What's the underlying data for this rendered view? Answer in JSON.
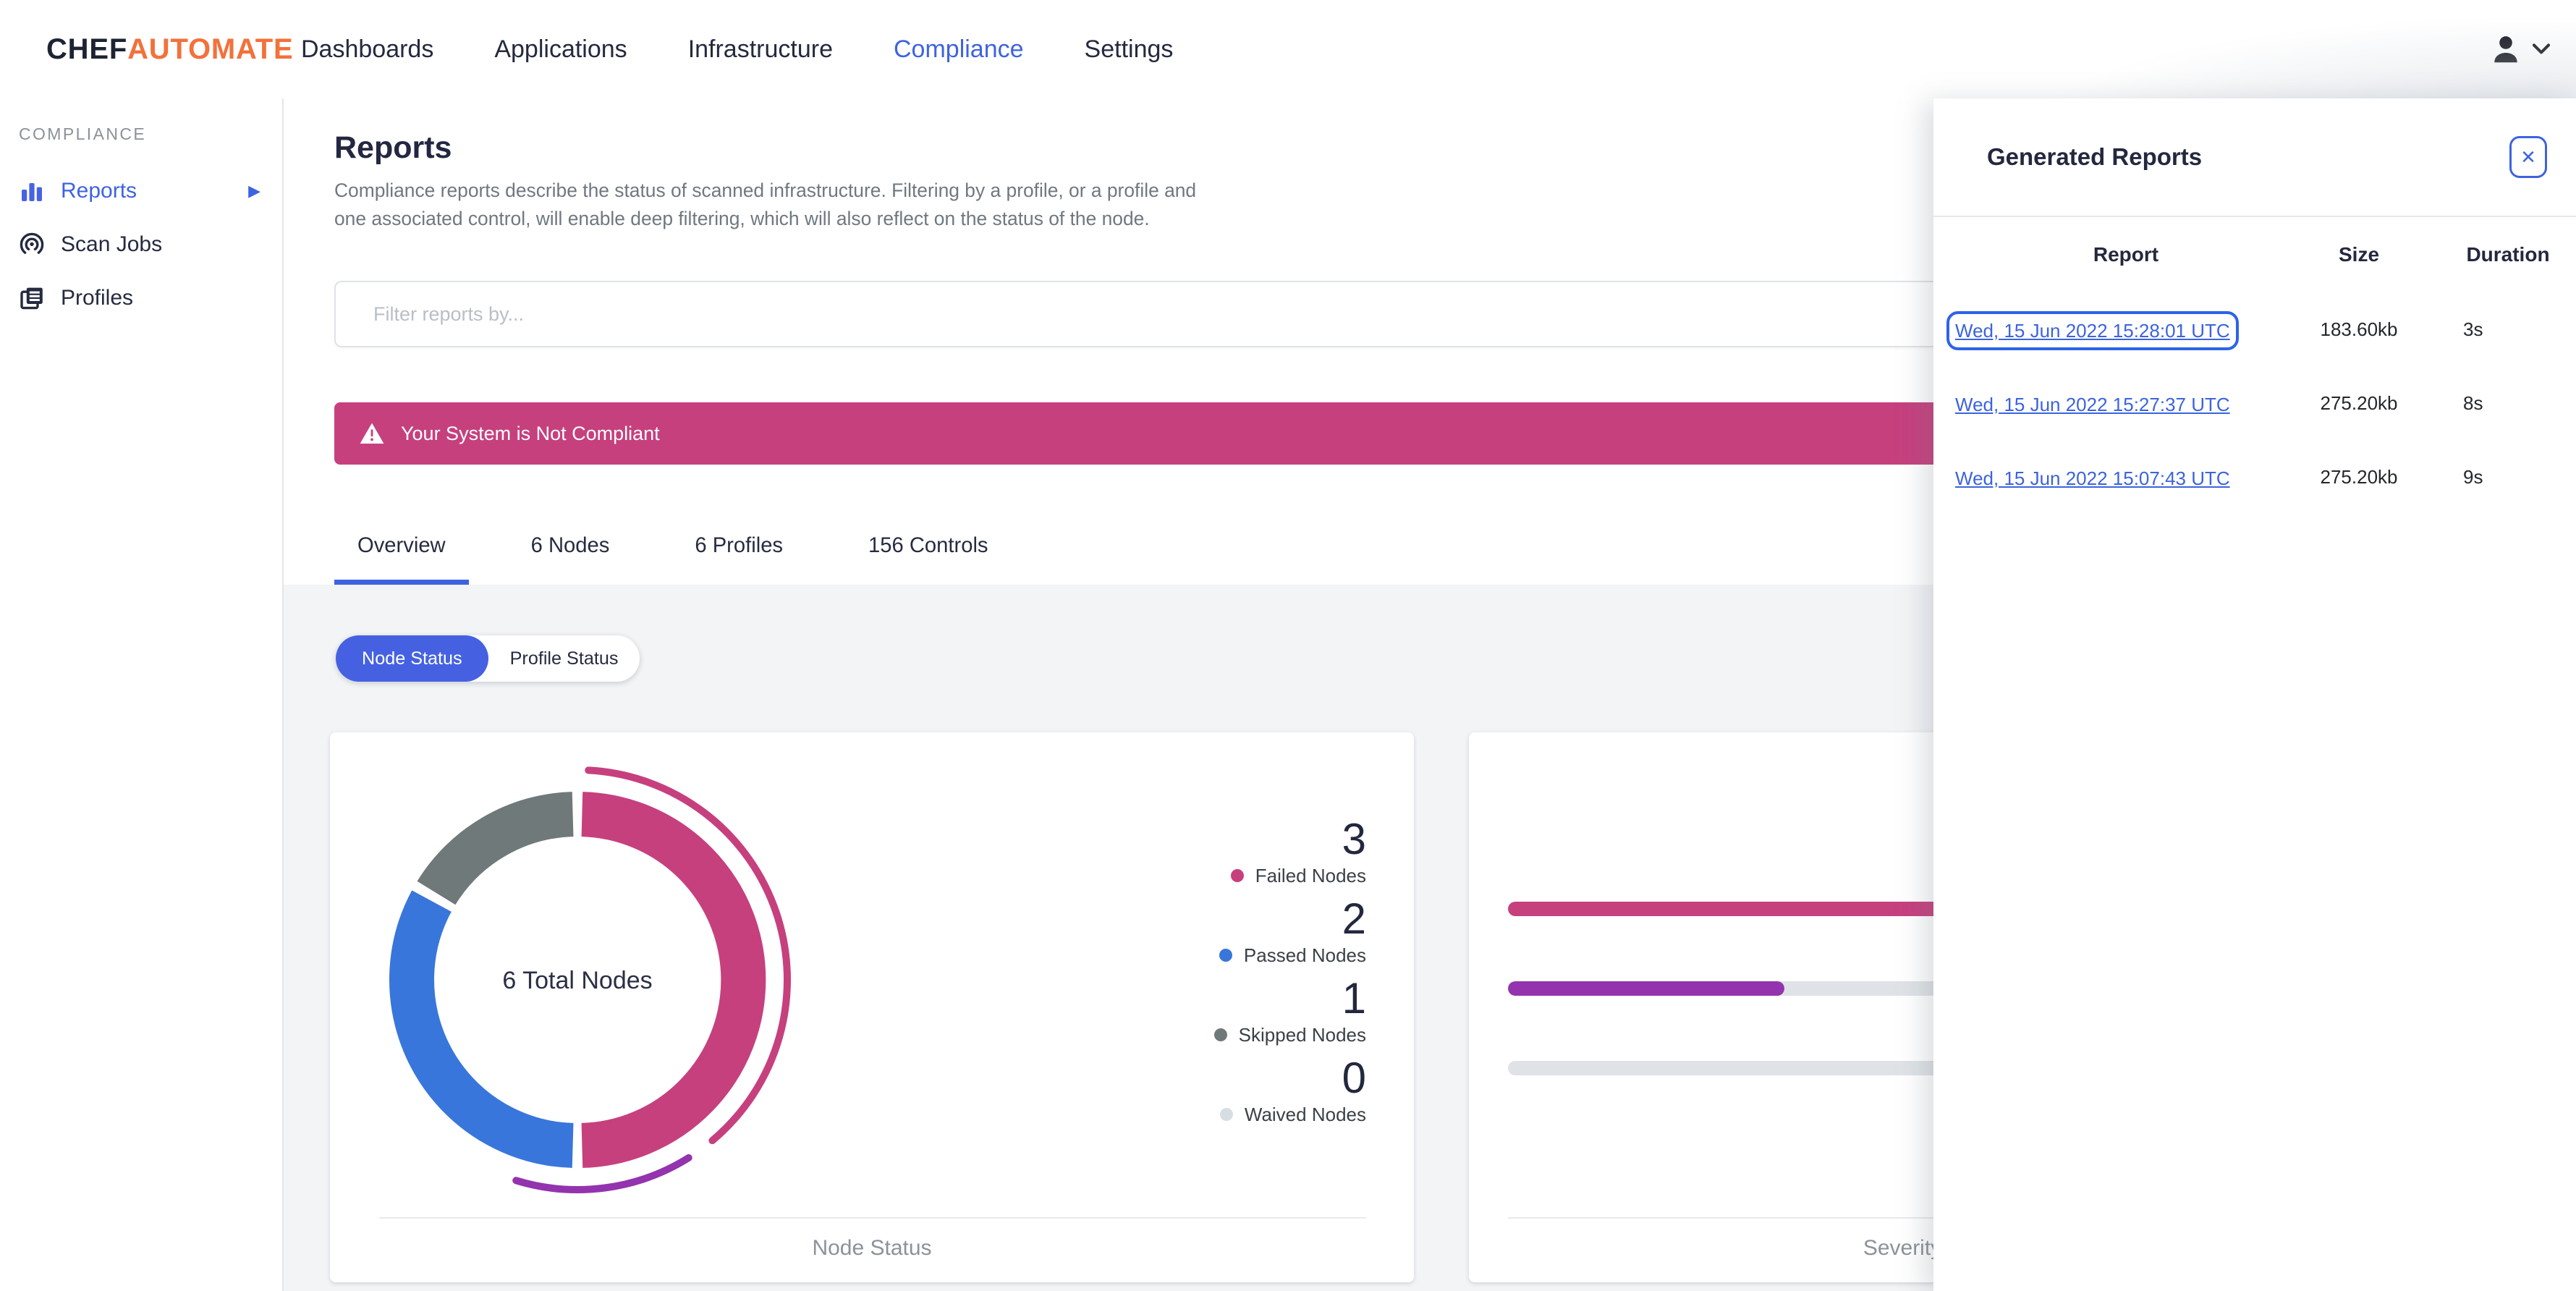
{
  "topnav": {
    "brand": {
      "part1": "CHEF",
      "part2": "AUTOMATE"
    },
    "items": [
      {
        "label": "Dashboards",
        "active": false
      },
      {
        "label": "Applications",
        "active": false
      },
      {
        "label": "Infrastructure",
        "active": false
      },
      {
        "label": "Compliance",
        "active": true
      },
      {
        "label": "Settings",
        "active": false
      }
    ]
  },
  "sidebar": {
    "section_label": "COMPLIANCE",
    "items": [
      {
        "label": "Reports",
        "icon": "bar-chart-icon",
        "active": true
      },
      {
        "label": "Scan Jobs",
        "icon": "scan-icon",
        "active": false
      },
      {
        "label": "Profiles",
        "icon": "documents-icon",
        "active": false
      }
    ]
  },
  "page": {
    "title": "Reports",
    "description": "Compliance reports describe the status of scanned infrastructure. Filtering by a profile, or a profile and\none associated control, will enable deep filtering, which will also reflect on the status of the node."
  },
  "filter": {
    "placeholder": "Filter reports by...",
    "value": ""
  },
  "banner": {
    "text": "Your System is Not Compliant",
    "color": "#C6407E",
    "icon": "warning-icon"
  },
  "tabs": [
    {
      "label": "Overview",
      "active": true
    },
    {
      "label": "6 Nodes",
      "active": false
    },
    {
      "label": "6 Profiles",
      "active": false
    },
    {
      "label": "156 Controls",
      "active": false
    }
  ],
  "status_toggle": [
    {
      "label": "Node Status",
      "active": true
    },
    {
      "label": "Profile Status",
      "active": false
    }
  ],
  "node_status_card": {
    "center_label": "6 Total Nodes",
    "footer_label": "Node Status",
    "legend": [
      {
        "value": "3",
        "label": "Failed Nodes",
        "color": "#C6407E"
      },
      {
        "value": "2",
        "label": "Passed Nodes",
        "color": "#3876DB"
      },
      {
        "value": "1",
        "label": "Skipped Nodes",
        "color": "#70797A"
      },
      {
        "value": "0",
        "label": "Waived Nodes",
        "color": "#D7DEE3"
      }
    ],
    "outer_arcs": [
      {
        "color": "#C6407E",
        "start_deg": 3,
        "end_deg": 140
      },
      {
        "color": "#9334AE",
        "start_deg": 148,
        "end_deg": 197
      }
    ]
  },
  "severity_card": {
    "footer_label": "Severity",
    "bars": [
      {
        "color": "#C6407E",
        "fill_pct": 100
      },
      {
        "color": "#9334AE",
        "fill_pct": 35
      },
      {
        "color": "#DFE3E7",
        "fill_pct": 0
      }
    ]
  },
  "generated_reports": {
    "title": "Generated Reports",
    "columns": [
      "Report",
      "Size",
      "Duration"
    ],
    "rows": [
      {
        "report": "Wed, 15 Jun 2022 15:28:01 UTC",
        "size": "183.60kb",
        "duration": "3s",
        "focused": true
      },
      {
        "report": "Wed, 15 Jun 2022 15:27:37 UTC",
        "size": "275.20kb",
        "duration": "8s",
        "focused": false
      },
      {
        "report": "Wed, 15 Jun 2022 15:07:43 UTC",
        "size": "275.20kb",
        "duration": "9s",
        "focused": false
      }
    ]
  },
  "chart_data": [
    {
      "type": "pie",
      "donut": true,
      "title": "Node Status",
      "labels": [
        "Failed Nodes",
        "Passed Nodes",
        "Skipped Nodes",
        "Waived Nodes"
      ],
      "values": [
        3,
        2,
        1,
        0
      ],
      "total_label": "6 Total Nodes",
      "colors": [
        "#C6407E",
        "#3876DB",
        "#70797A",
        "#D7DEE3"
      ],
      "legend_position": "right"
    },
    {
      "type": "bar",
      "orientation": "horizontal",
      "title": "Severity",
      "categories": [
        "bar-1",
        "bar-2",
        "bar-3"
      ],
      "values_pct": [
        100,
        35,
        0
      ],
      "colors": [
        "#C6407E",
        "#9334AE",
        "#DFE3E7"
      ]
    }
  ]
}
